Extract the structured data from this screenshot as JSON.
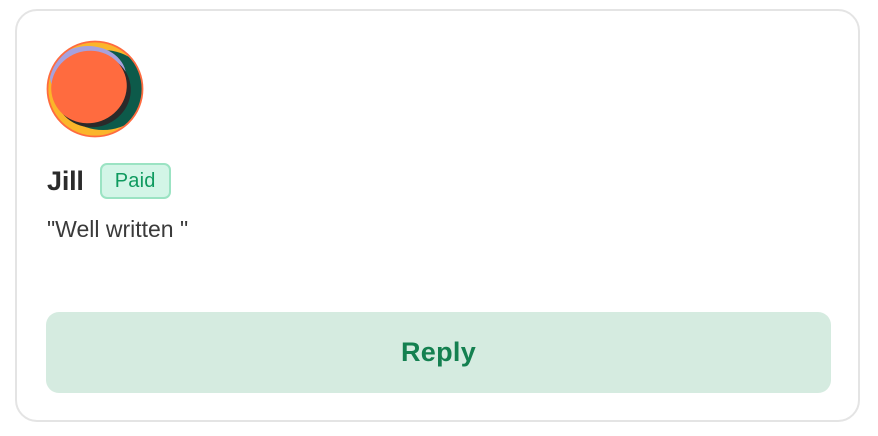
{
  "comment_card": {
    "author_name": "Jill",
    "badge_label": "Paid",
    "comment_text": "\"Well written \"",
    "reply_label": "Reply",
    "avatar_icon": "abstract-shapes-avatar"
  },
  "colors": {
    "badge_bg": "#d3f5e7",
    "badge_border": "#9be3c3",
    "badge_text": "#0f9a5f",
    "reply_bg": "#d5ebe0",
    "reply_text": "#148050",
    "avatar_orange": "#ff6b3f",
    "avatar_teal": "#0d5a4a",
    "avatar_yellow": "#fbb52a",
    "avatar_lavender": "#a6a1dd"
  }
}
